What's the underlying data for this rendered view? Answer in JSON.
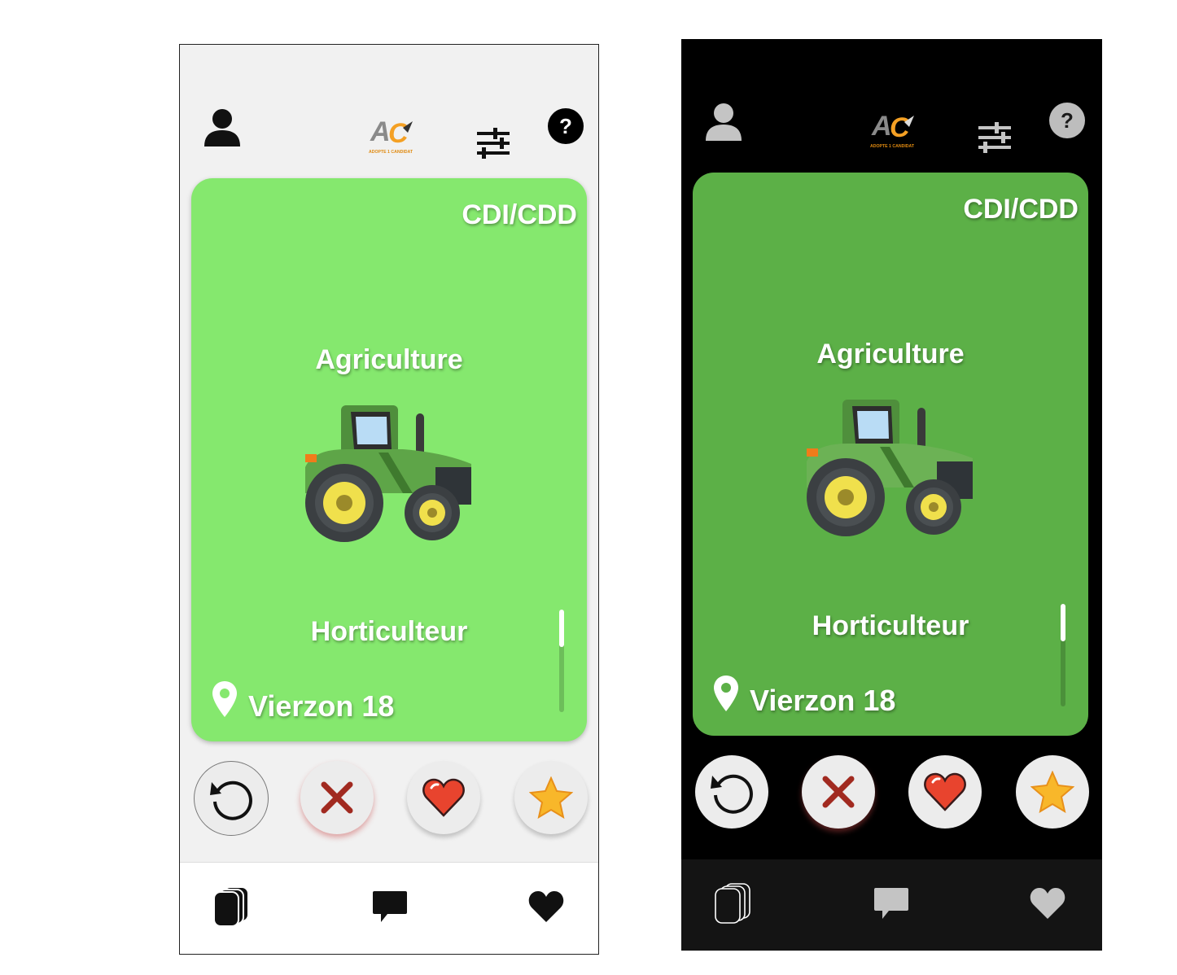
{
  "screens": [
    {
      "theme": "light",
      "header": {
        "profile_icon": "user-icon",
        "logo": {
          "text": "AC",
          "tagline": "ADOPTE 1 CANDIDAT"
        },
        "filters_icon": "sliders-icon",
        "help_label": "?"
      },
      "card": {
        "contract": "CDI/CDD",
        "sector": "Agriculture",
        "illustration": "tractor-icon",
        "job_title": "Horticulteur",
        "location": "Vierzon 18",
        "background_color": "#85e86e"
      },
      "actions": [
        "rewind-icon",
        "close-icon",
        "heart-icon",
        "star-icon"
      ],
      "tabs": [
        "cards-icon",
        "chat-icon",
        "heart-icon"
      ]
    },
    {
      "theme": "dark",
      "header": {
        "profile_icon": "user-icon",
        "logo": {
          "text": "AC",
          "tagline": "ADOPTE 1 CANDIDAT"
        },
        "filters_icon": "sliders-icon",
        "help_label": "?"
      },
      "card": {
        "contract": "CDI/CDD",
        "sector": "Agriculture",
        "illustration": "tractor-icon",
        "job_title": "Horticulteur",
        "location": "Vierzon 18",
        "background_color": "#5cb047"
      },
      "actions": [
        "rewind-icon",
        "close-icon",
        "heart-icon",
        "star-icon"
      ],
      "tabs": [
        "cards-icon",
        "chat-icon",
        "heart-icon"
      ]
    }
  ]
}
